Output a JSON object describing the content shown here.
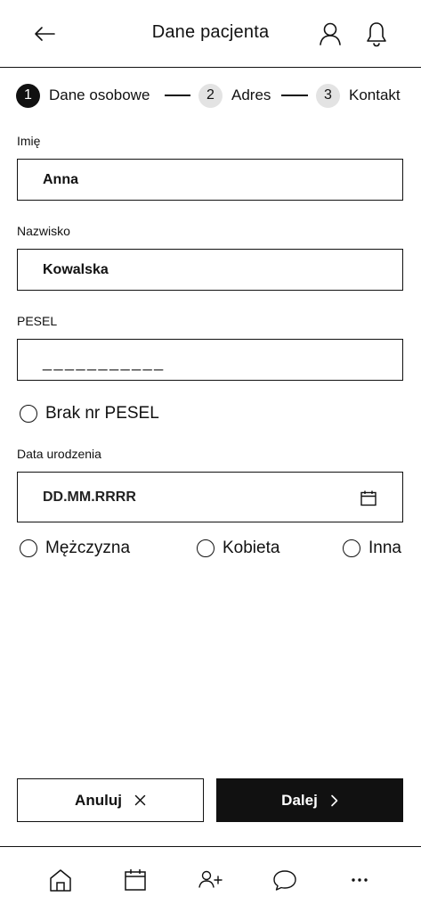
{
  "header": {
    "title": "Dane pacjenta",
    "back_icon": "arrow-left-icon",
    "user_icon": "user-icon",
    "bell_icon": "bell-icon"
  },
  "stepper": {
    "steps": [
      {
        "number": "1",
        "label": "Dane osobowe",
        "active": true
      },
      {
        "number": "2",
        "label": "Adres",
        "active": false
      },
      {
        "number": "3",
        "label": "Kontakt",
        "active": false
      }
    ]
  },
  "form": {
    "first_name": {
      "label": "Imię",
      "value": "Anna"
    },
    "last_name": {
      "label": "Nazwisko",
      "value": "Kowalska"
    },
    "pesel": {
      "label": "PESEL",
      "placeholder": "___________"
    },
    "no_pesel": {
      "label": "Brak nr PESEL",
      "checked": false
    },
    "birth_date": {
      "label": "Data urodzenia",
      "placeholder": "DD.MM.RRRR",
      "icon": "calendar-icon"
    },
    "gender": {
      "options": [
        "Mężczyzna",
        "Kobieta",
        "Inna"
      ],
      "selected": null
    }
  },
  "actions": {
    "cancel_label": "Anuluj",
    "next_label": "Dalej"
  },
  "bottom_nav": {
    "items": [
      "home-icon",
      "calendar-icon",
      "add-user-icon",
      "chat-icon",
      "more-icon"
    ]
  },
  "colors": {
    "primary": "#111111",
    "background": "#ffffff",
    "step_inactive": "#e3e3e3"
  }
}
